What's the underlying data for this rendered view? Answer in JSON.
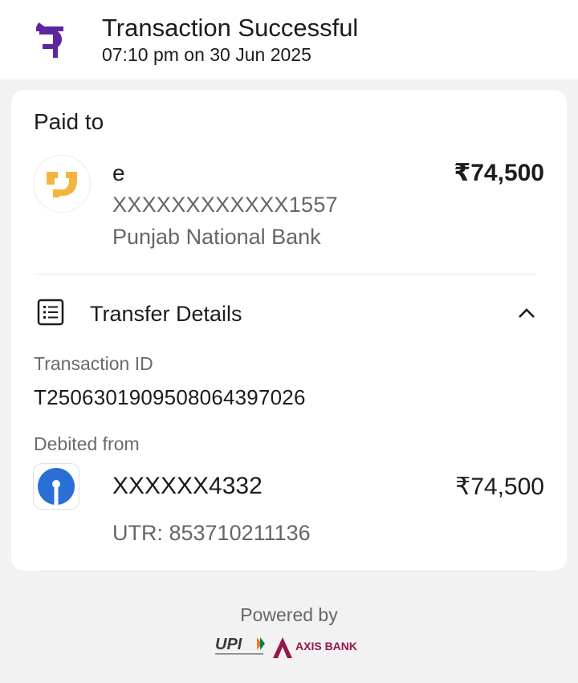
{
  "header": {
    "title": "Transaction Successful",
    "timestamp": "07:10 pm on 30 Jun 2025",
    "logo_icon": "phonepe-logo-icon",
    "brand_color": "#5f259f"
  },
  "paid_to": {
    "heading": "Paid to",
    "name": "e",
    "account": "XXXXXXXXXXXX1557",
    "bank": "Punjab National Bank",
    "amount": "₹74,500",
    "bank_logo_icon": "pnb-logo-icon",
    "bank_logo_color": "#f4b53f"
  },
  "transfer_details": {
    "title": "Transfer Details",
    "icon": "receipt-list-icon",
    "toggle_icon": "chevron-up-icon",
    "transaction_id_label": "Transaction ID",
    "transaction_id": "T2506301909508064397026",
    "debited_from_label": "Debited from",
    "debit_account": "XXXXXX4332",
    "debit_amount": "₹74,500",
    "utr": "UTR: 853710211136",
    "debit_bank_logo_icon": "sbi-logo-icon",
    "debit_bank_color": "#2a6fd6"
  },
  "footer": {
    "powered_by": "Powered by",
    "upi_text": "UPI",
    "bank_text": "AXIS BANK",
    "axis_color": "#97144d"
  }
}
